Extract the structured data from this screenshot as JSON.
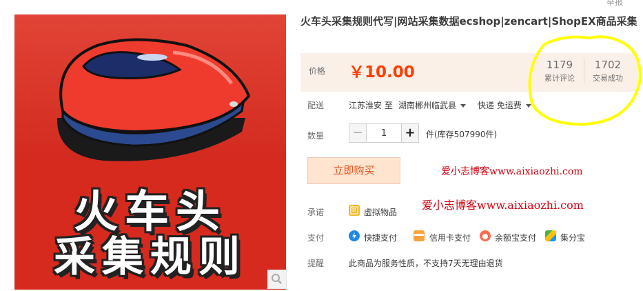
{
  "header": {
    "report_label": "举报"
  },
  "product": {
    "title": "火车头采集规则代写|网站采集数据ecshop|zencart|ShopEX商品采集",
    "image_caption_line1": "火车头",
    "image_caption_line2": "采集规则"
  },
  "price": {
    "label": "价格",
    "value": "￥10.00"
  },
  "stats": {
    "reviews_count": "1179",
    "reviews_label": "累计评论",
    "sales_count": "1702",
    "sales_label": "交易成功"
  },
  "delivery": {
    "label": "配送",
    "from": "江苏淮安",
    "to_word": "至",
    "destination": "湖南郴州临武县",
    "shipping": "快递 免运费"
  },
  "quantity": {
    "label": "数量",
    "minus": "−",
    "value": "1",
    "plus": "+",
    "stock": "件(库存507990件)"
  },
  "buy": {
    "label": "立即购买"
  },
  "watermarks": {
    "line1": "爱小志博客www.aixiaozhi.com",
    "line2": "爱小志博客www.aixiaozhi.com"
  },
  "promise": {
    "label": "承诺",
    "item": "虚拟物品"
  },
  "payment": {
    "label": "支付",
    "methods": [
      "快捷支付",
      "信用卡支付",
      "余额宝支付",
      "集分宝"
    ]
  },
  "notice": {
    "label": "提醒",
    "text": "此商品为服务性质，不支持7天无理由退货"
  },
  "colors": {
    "price": "#ff3e00",
    "accent_panel": "#fbf0e8",
    "highlight": "#ffff00"
  }
}
